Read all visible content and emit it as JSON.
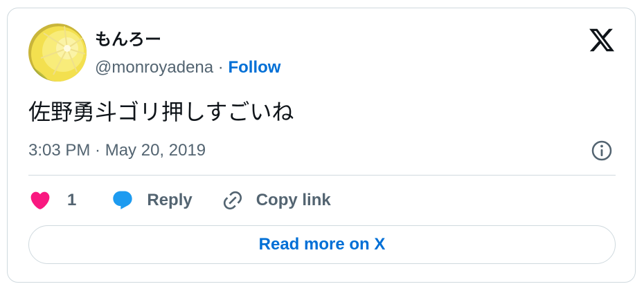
{
  "author": {
    "display_name": "もんろー",
    "handle": "@monroyadena",
    "separator": " · ",
    "follow_label": "Follow"
  },
  "tweet": {
    "text": "佐野勇斗ゴリ押しすごいね",
    "timestamp": "3:03 PM · May 20, 2019"
  },
  "actions": {
    "like_count": "1",
    "reply_label": "Reply",
    "copy_link_label": "Copy link"
  },
  "read_more_label": "Read more on X",
  "colors": {
    "like": "#f91880",
    "reply": "#1d9bf0",
    "link": "#006fd6",
    "text": "#0f1419",
    "muted": "#536471",
    "border": "#cfd9de"
  },
  "icons": [
    "avatar-lemon",
    "x-logo-icon",
    "info-icon",
    "heart-icon",
    "reply-bubble-icon",
    "link-icon"
  ]
}
